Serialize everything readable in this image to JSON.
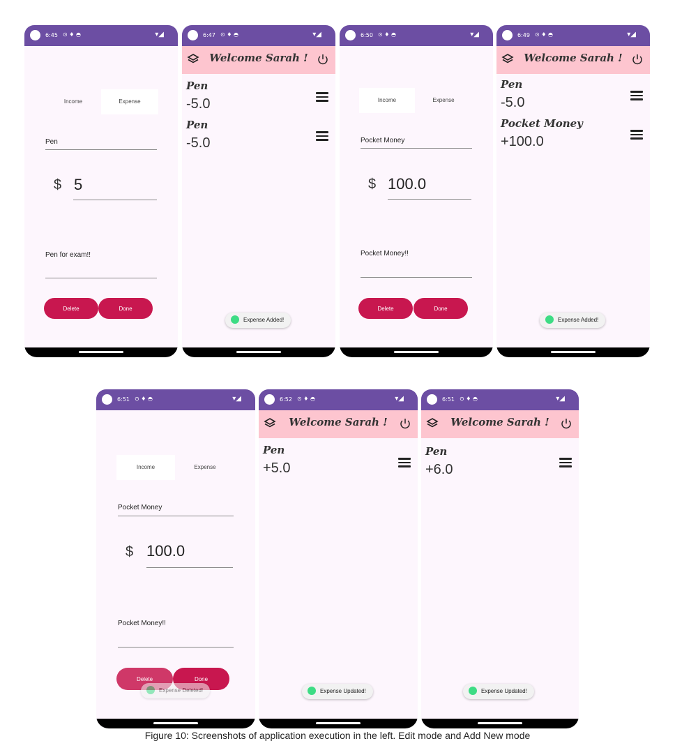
{
  "statusbar": {
    "icons": "⊙ ♦ ◓",
    "net": "▾◢"
  },
  "screen1": {
    "time": "6:45",
    "tab_income": "Income",
    "tab_expense": "Expense",
    "title_value": "Pen",
    "dollar": "$",
    "amount": "5",
    "note": "Pen for exam!!",
    "delete_label": "Delete",
    "done_label": "Done",
    "selected_tab": "Expense"
  },
  "screen2": {
    "time": "6:47",
    "header": "Welcome Sarah !",
    "items": [
      {
        "name": "Pen",
        "amount": "-5.0"
      },
      {
        "name": "Pen",
        "amount": "-5.0"
      }
    ],
    "toast": "Expense Added!"
  },
  "screen3": {
    "time": "6:50",
    "tab_income": "Income",
    "tab_expense": "Expense",
    "title_value": "Pocket Money",
    "dollar": "$",
    "amount": "100.0",
    "note": "Pocket Money!!",
    "delete_label": "Delete",
    "done_label": "Done",
    "selected_tab": "Income"
  },
  "screen4": {
    "time": "6:49",
    "header": "Welcome Sarah !",
    "items": [
      {
        "name": "Pen",
        "amount": "-5.0"
      },
      {
        "name": "Pocket Money",
        "amount": "+100.0"
      }
    ],
    "toast": "Expense Added!"
  },
  "screen5": {
    "time": "6:51",
    "tab_income": "Income",
    "tab_expense": "Expense",
    "title_value": "Pocket Money",
    "dollar": "$",
    "amount": "100.0",
    "note": "Pocket Money!!",
    "delete_label": "Delete",
    "done_label": "Done",
    "selected_tab": "Income",
    "toast": "Expense Deleted!"
  },
  "screen6": {
    "time": "6:52",
    "header": "Welcome Sarah !",
    "items": [
      {
        "name": "Pen",
        "amount": "+5.0"
      }
    ],
    "toast": "Expense Updated!"
  },
  "screen7": {
    "time": "6:51",
    "header": "Welcome Sarah !",
    "items": [
      {
        "name": "Pen",
        "amount": "+6.0"
      }
    ],
    "toast": "Expense Updated!"
  },
  "caption": "Figure 10: Screenshots of application execution in the left. Edit mode and Add New mode",
  "colors": {
    "statusbar": "#6c4ea3",
    "appbar": "#fdc5cf",
    "background": "#fdf6fd",
    "button": "#c8174f",
    "toast_icon": "#3ddc84"
  }
}
